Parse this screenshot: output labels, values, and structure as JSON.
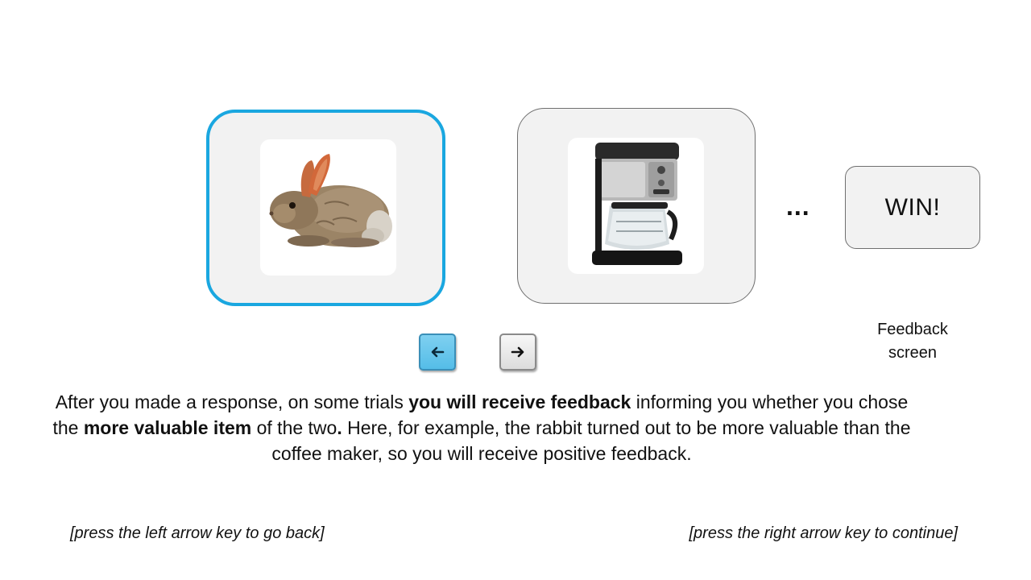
{
  "options": {
    "left": {
      "item": "rabbit-image",
      "selected": true
    },
    "right": {
      "item": "coffee-maker-image",
      "selected": false
    }
  },
  "ellipsis": "...",
  "feedback": {
    "text": "WIN!",
    "caption_line1": "Feedback",
    "caption_line2": "screen"
  },
  "keys": {
    "left": {
      "icon": "arrow-left-icon",
      "active": true
    },
    "right": {
      "icon": "arrow-right-icon",
      "active": false
    }
  },
  "instructions": {
    "p1": "After you made a response, on some trials ",
    "b1": "you will receive feedback",
    "p2": " informing you whether you chose the ",
    "b2": "more valuable item",
    "p3": " of the two",
    "b3": ".",
    "p4": " Here, for example, the rabbit turned out to be more valuable than the coffee maker, so you will receive positive feedback."
  },
  "navigation": {
    "back": "[press the left arrow key to go back]",
    "continue": "[press the right arrow key to continue]"
  },
  "colors": {
    "selection_border": "#1aa7e0",
    "card_bg": "#f2f2f2",
    "left_key_bg": "#6ecbee"
  }
}
